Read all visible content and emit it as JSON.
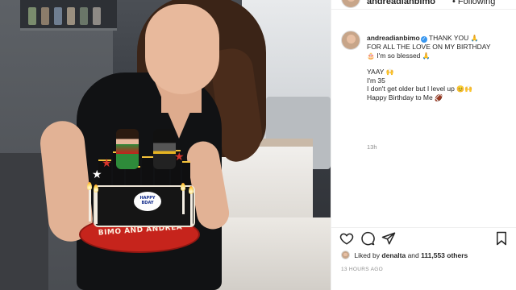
{
  "header": {
    "username": "andreadianbimo",
    "follow_status": "• Following"
  },
  "photo": {
    "plate_text": "BIMO AND ANDREA",
    "badge_line1": "HAPPY",
    "badge_line2": "BDAY"
  },
  "caption": {
    "username": "andreadianbimo",
    "line1": "THANK YOU",
    "line1_emoji": "🙏",
    "line2": "FOR ALL THE LOVE ON MY BIRTHDAY",
    "line3_emoji": "🎂",
    "line3": "I'm so blessed",
    "line3_emoji2": "🙏",
    "line4": "YAAY",
    "line4_emoji": "🙌",
    "line5": "I'm 35",
    "line6": "I don't get older but I level up",
    "line6_emoji": "😊🙌",
    "line7": "Happy Birthday to Me",
    "line7_emoji": "🏈",
    "time": "13h"
  },
  "actions": {
    "liked_by_prefix": "Liked by",
    "liked_by_user": "denalta",
    "liked_by_and": "and",
    "likes_count": "111,553 others",
    "posted_ago": "13 HOURS AGO"
  },
  "colors": {
    "verified": "#3897f0",
    "text": "#262626",
    "muted": "#8e8e8e"
  }
}
